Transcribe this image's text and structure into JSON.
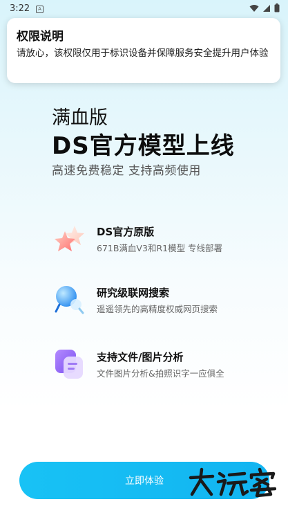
{
  "status_bar": {
    "time": "3:22",
    "notif_letter": "A"
  },
  "dialog": {
    "title": "权限说明",
    "body": "请放心，该权限仅用于标识设备并保障服务安全提升用户体验"
  },
  "hero": {
    "subtitle": "满血版",
    "title": "DS官方模型上线",
    "tagline": "高速免费稳定 支持高频使用"
  },
  "features": [
    {
      "icon": "star-icon",
      "title": "DS官方原版",
      "desc": "671B满血V3和R1模型 专线部署"
    },
    {
      "icon": "globe-search-icon",
      "title": "研究级联网搜索",
      "desc": "遥遥领先的高精度权威网页搜索"
    },
    {
      "icon": "document-icon",
      "title": "支持文件/图片分析",
      "desc": "文件图片分析&拍照识字一应俱全"
    }
  ],
  "cta": {
    "label": "立即体验"
  },
  "watermark": {
    "icon": "watermark-logo-icon"
  },
  "colors": {
    "accent": "#14bbf3",
    "background_top": "#d9f4fb"
  }
}
